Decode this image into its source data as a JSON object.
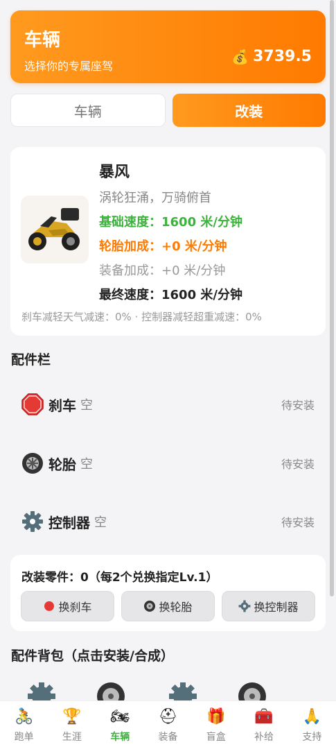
{
  "header": {
    "title": "车辆",
    "subtitle": "选择你的专属座驾",
    "money": "3739.5",
    "money_icon": "money-bag-icon"
  },
  "tabs": [
    {
      "label": "车辆",
      "active": false
    },
    {
      "label": "改装",
      "active": true
    }
  ],
  "vehicle": {
    "name": "暴风",
    "desc": "涡轮狂涌，万骑俯首",
    "base_speed": "基础速度：1600 米/分钟",
    "tire_bonus": "轮胎加成：+0 米/分钟",
    "equip_bonus": "装备加成：+0 米/分钟",
    "final_speed": "最终速度：1600 米/分钟",
    "footnote": "刹车减轻天气减速：0% · 控制器减轻超重减速：0%"
  },
  "slots_title": "配件栏",
  "slots": [
    {
      "name": "刹车",
      "state": "空",
      "status": "待安装",
      "icon": "stop-sign-icon"
    },
    {
      "name": "轮胎",
      "state": "空",
      "status": "待安装",
      "icon": "tire-icon"
    },
    {
      "name": "控制器",
      "state": "空",
      "status": "待安装",
      "icon": "gear-icon"
    }
  ],
  "parts": {
    "title": "改装零件：0（每2个兑换指定Lv.1）",
    "buttons": [
      {
        "label": "换刹车",
        "icon": "red-dot-icon"
      },
      {
        "label": "换轮胎",
        "icon": "tire-icon"
      },
      {
        "label": "换控制器",
        "icon": "gear-icon"
      }
    ]
  },
  "bag_title": "配件背包（点击安装/合成）",
  "nav": [
    {
      "label": "跑单",
      "icon": "cyclist-icon",
      "active": false
    },
    {
      "label": "生涯",
      "icon": "trophy-icon",
      "active": false
    },
    {
      "label": "车辆",
      "icon": "motorcycle-icon",
      "active": true
    },
    {
      "label": "装备",
      "icon": "helmet-icon",
      "active": false
    },
    {
      "label": "盲盒",
      "icon": "gift-icon",
      "active": false
    },
    {
      "label": "补给",
      "icon": "medkit-icon",
      "active": false
    },
    {
      "label": "支持",
      "icon": "hands-icon",
      "active": false
    }
  ],
  "colors": {
    "accent": "#ff7a00",
    "green": "#3bb33b"
  }
}
